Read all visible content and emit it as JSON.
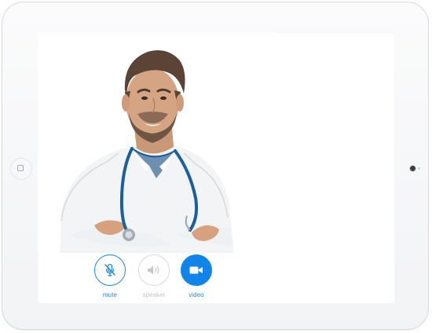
{
  "call_controls": [
    {
      "id": "mute",
      "label": "mute",
      "icon": "microphone-off-icon"
    },
    {
      "id": "speaker",
      "label": "speaker",
      "icon": "speaker-icon"
    },
    {
      "id": "video",
      "label": "video",
      "icon": "video-camera-icon"
    }
  ],
  "colors": {
    "accent": "#1a8bea",
    "disabled": "#c0c4c8",
    "bezel": "#f4f5f7"
  }
}
